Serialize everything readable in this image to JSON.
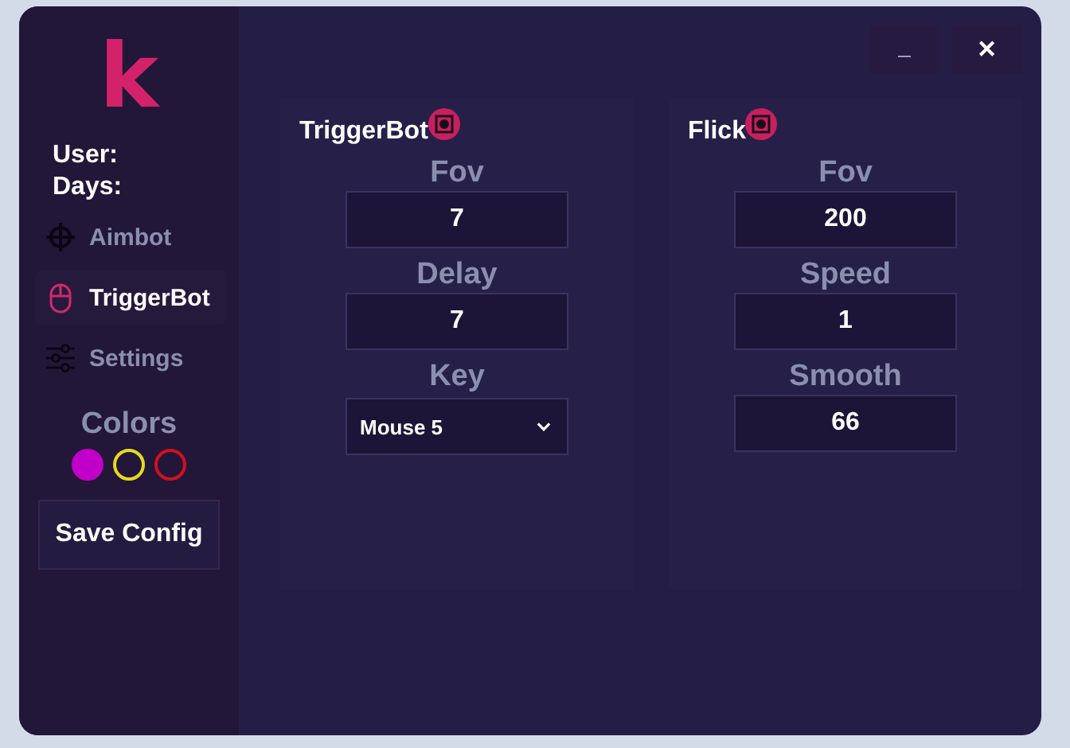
{
  "window": {
    "controls": [
      {
        "kind": "minimize",
        "label": "_"
      },
      {
        "kind": "close",
        "label": "✕"
      }
    ]
  },
  "sidebar": {
    "logo": "k",
    "user_label": "User:",
    "days_label": "Days:",
    "items": [
      {
        "label": "Aimbot",
        "kind": "crosshair",
        "selected": false
      },
      {
        "label": "TriggerBot",
        "kind": "mouse",
        "selected": true
      },
      {
        "label": "Settings",
        "kind": "sliders",
        "selected": false
      }
    ],
    "colors_title": "Colors",
    "colors": [
      {
        "color": "#c000c8",
        "selected": true
      },
      {
        "color": "#e8d820",
        "selected": false
      },
      {
        "color": "#d01020",
        "selected": false
      }
    ],
    "save_button": "Save Config"
  },
  "panels": [
    {
      "title": "TriggerBot",
      "fields": [
        {
          "kind": "number",
          "label": "Fov",
          "value": "7"
        },
        {
          "kind": "number",
          "label": "Delay",
          "value": "7"
        },
        {
          "kind": "select",
          "label": "Key",
          "value": "Mouse 5"
        }
      ]
    },
    {
      "title": "Flick",
      "fields": [
        {
          "kind": "number",
          "label": "Fov",
          "value": "200"
        },
        {
          "kind": "number",
          "label": "Speed",
          "value": "1"
        },
        {
          "kind": "number",
          "label": "Smooth",
          "value": "66"
        }
      ]
    }
  ]
}
